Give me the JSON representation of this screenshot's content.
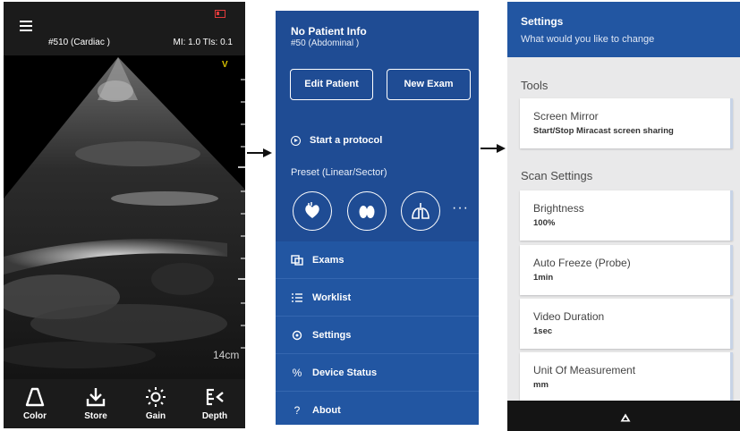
{
  "scan": {
    "preset_label": "#510 (Cardiac )",
    "mi_tis": "MI: 1.0 TIs: 0.1",
    "orientation_mark": "V",
    "depth": "14cm",
    "toolbar": [
      {
        "label": "Color",
        "icon": "color-doppler-icon"
      },
      {
        "label": "Store",
        "icon": "store-icon"
      },
      {
        "label": "Gain",
        "icon": "gain-icon"
      },
      {
        "label": "Depth",
        "icon": "depth-icon"
      }
    ]
  },
  "menu": {
    "patient_title": "No Patient Info",
    "patient_exam": "#50 (Abdominal )",
    "edit_patient": "Edit Patient",
    "new_exam": "New Exam",
    "start_protocol": "Start a protocol",
    "preset_label": "Preset (Linear/Sector)",
    "preset_icons": [
      "heart-icon",
      "thyroid-icon",
      "lungs-icon"
    ],
    "more": "···",
    "items": [
      {
        "label": "Exams",
        "icon": "exams-icon"
      },
      {
        "label": "Worklist",
        "icon": "worklist-icon"
      },
      {
        "label": "Settings",
        "icon": "settings-icon"
      },
      {
        "label": "Device Status",
        "icon": "percent-icon"
      },
      {
        "label": "About",
        "icon": "question-icon"
      }
    ]
  },
  "settings": {
    "title": "Settings",
    "subtitle": "What would you like to change",
    "tools_section": "Tools",
    "scan_section": "Scan Settings",
    "screen_mirror": {
      "title": "Screen Mirror",
      "value": "Start/Stop Miracast screen sharing"
    },
    "brightness": {
      "title": "Brightness",
      "value": "100%"
    },
    "auto_freeze": {
      "title": "Auto Freeze (Probe)",
      "value": "1min"
    },
    "video_duration": {
      "title": "Video Duration",
      "value": "1sec"
    },
    "unit": {
      "title": "Unit Of Measurement",
      "value": "mm"
    }
  },
  "colors": {
    "menu_blue": "#1f4c94",
    "header_blue": "#2256a2",
    "battery_red": "#e23b3b",
    "orientation_yellow": "#d6c000"
  }
}
